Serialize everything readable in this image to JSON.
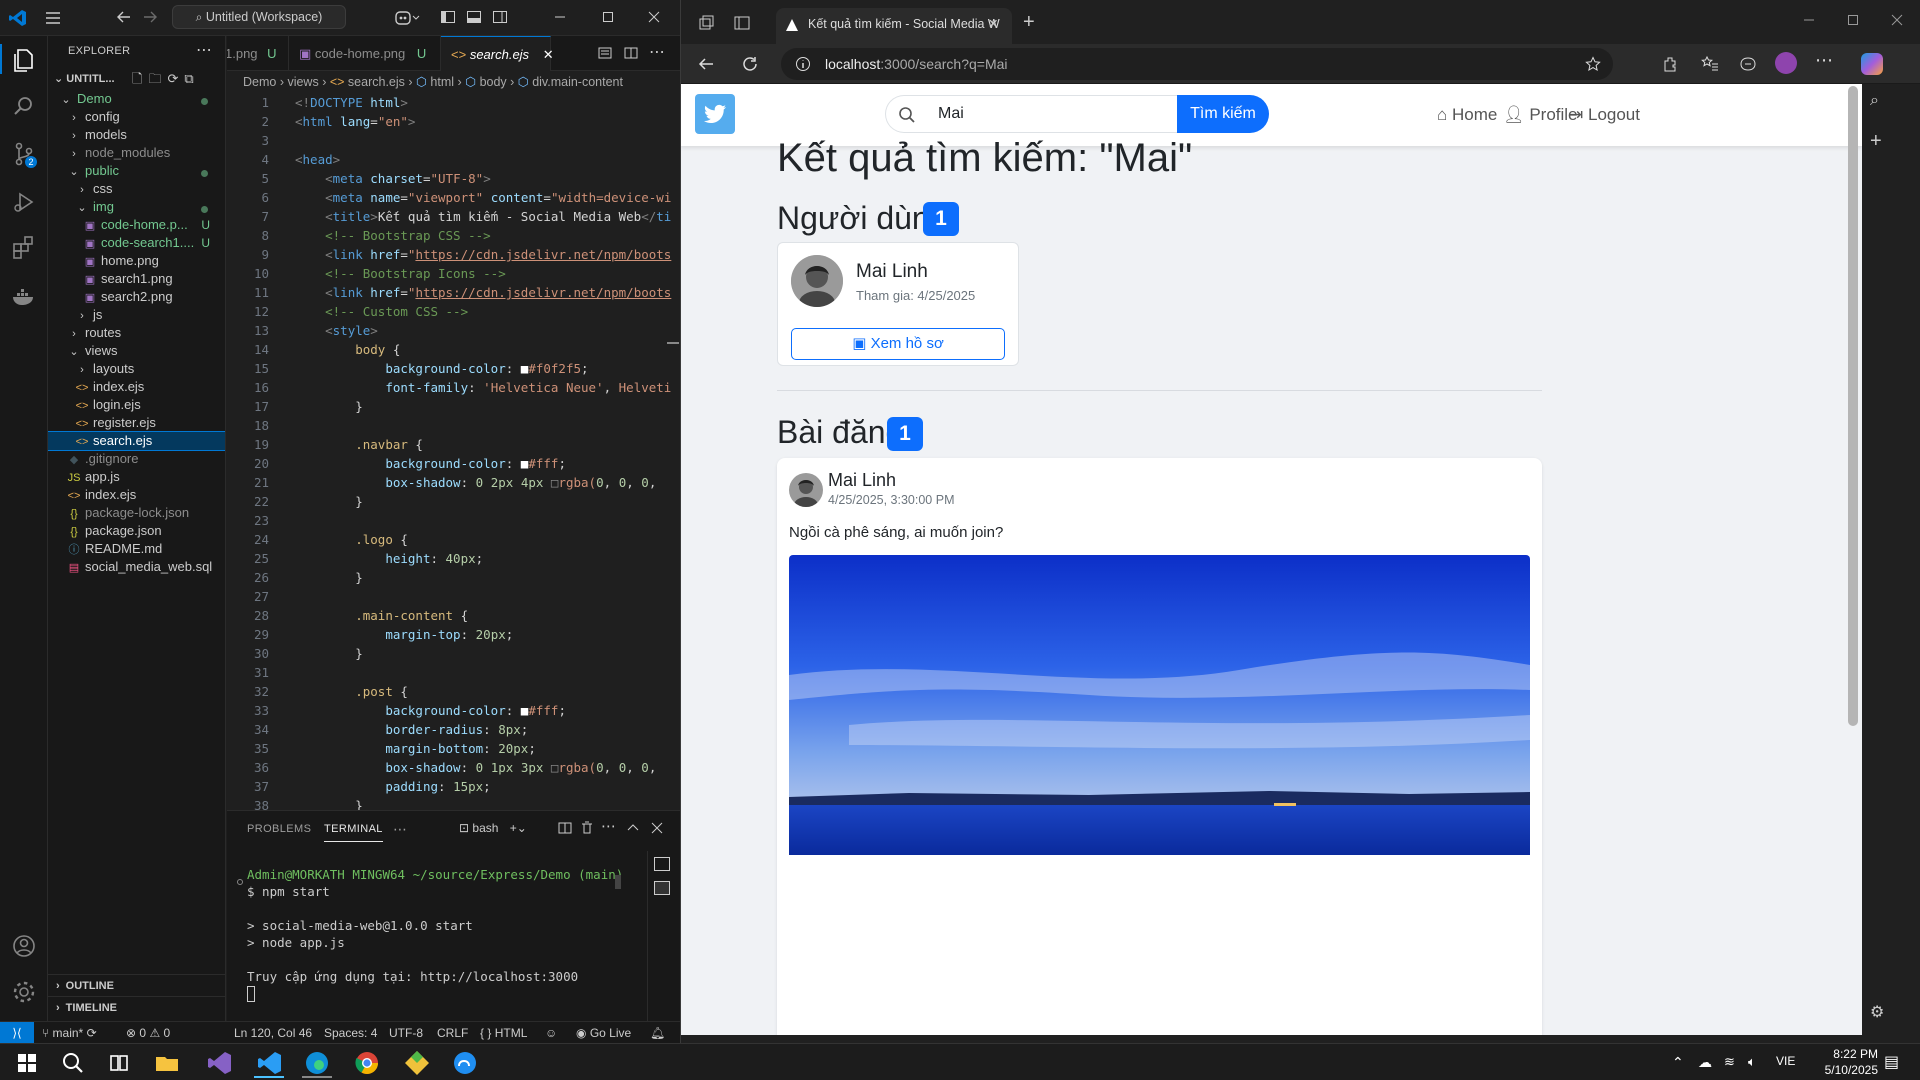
{
  "vscode": {
    "search_label": "Untitled (Workspace)",
    "explorer_title": "EXPLORER",
    "workspace": "UNTITL...",
    "tree": [
      {
        "label": "Demo",
        "depth": 1,
        "kind": "folder-open",
        "color": "#73c991",
        "dot": true
      },
      {
        "label": "config",
        "depth": 2,
        "kind": "folder",
        "color": "#ccc"
      },
      {
        "label": "models",
        "depth": 2,
        "kind": "folder",
        "color": "#ccc"
      },
      {
        "label": "node_modules",
        "depth": 2,
        "kind": "folder",
        "color": "#8c8c8c"
      },
      {
        "label": "public",
        "depth": 2,
        "kind": "folder-open",
        "color": "#73c991",
        "dot": true
      },
      {
        "label": "css",
        "depth": 3,
        "kind": "folder",
        "color": "#ccc"
      },
      {
        "label": "img",
        "depth": 3,
        "kind": "folder-open",
        "color": "#73c991",
        "dot": true
      },
      {
        "label": "code-home.p...",
        "depth": 4,
        "kind": "img",
        "color": "#73c991",
        "badge": "U"
      },
      {
        "label": "code-search1....",
        "depth": 4,
        "kind": "img",
        "color": "#73c991",
        "badge": "U"
      },
      {
        "label": "home.png",
        "depth": 4,
        "kind": "img",
        "color": "#ccc"
      },
      {
        "label": "search1.png",
        "depth": 4,
        "kind": "img",
        "color": "#ccc"
      },
      {
        "label": "search2.png",
        "depth": 4,
        "kind": "img",
        "color": "#ccc"
      },
      {
        "label": "js",
        "depth": 3,
        "kind": "folder",
        "color": "#ccc"
      },
      {
        "label": "routes",
        "depth": 2,
        "kind": "folder",
        "color": "#ccc"
      },
      {
        "label": "views",
        "depth": 2,
        "kind": "folder-open",
        "color": "#ccc"
      },
      {
        "label": "layouts",
        "depth": 3,
        "kind": "folder",
        "color": "#ccc"
      },
      {
        "label": "index.ejs",
        "depth": 3,
        "kind": "ejs",
        "color": "#ccc"
      },
      {
        "label": "login.ejs",
        "depth": 3,
        "kind": "ejs",
        "color": "#ccc"
      },
      {
        "label": "register.ejs",
        "depth": 3,
        "kind": "ejs",
        "color": "#ccc"
      },
      {
        "label": "search.ejs",
        "depth": 3,
        "kind": "ejs",
        "color": "#fff",
        "selected": true
      },
      {
        "label": ".gitignore",
        "depth": 2,
        "kind": "git",
        "color": "#8c8c8c"
      },
      {
        "label": "app.js",
        "depth": 2,
        "kind": "js",
        "color": "#ccc"
      },
      {
        "label": "index.ejs",
        "depth": 2,
        "kind": "ejs",
        "color": "#ccc"
      },
      {
        "label": "package-lock.json",
        "depth": 2,
        "kind": "json",
        "color": "#8c8c8c"
      },
      {
        "label": "package.json",
        "depth": 2,
        "kind": "json",
        "color": "#ccc"
      },
      {
        "label": "README.md",
        "depth": 2,
        "kind": "md",
        "color": "#ccc"
      },
      {
        "label": "social_media_web.sql",
        "depth": 2,
        "kind": "sql",
        "color": "#ccc"
      }
    ],
    "outline": "OUTLINE",
    "timeline": "TIMELINE",
    "tabs": [
      {
        "label": "1.png",
        "badge": "U",
        "active": false
      },
      {
        "label": "code-home.png",
        "badge": "U",
        "active": false
      },
      {
        "label": "search.ejs",
        "badge": "",
        "active": true
      }
    ],
    "breadcrumb": [
      "Demo",
      "views",
      "search.ejs",
      "html",
      "body",
      "div.main-content"
    ],
    "line_numbers": [
      "1",
      "2",
      "3",
      "4",
      "5",
      "6",
      "7",
      "8",
      "9",
      "10",
      "11",
      "12",
      "13",
      "14",
      "15",
      "16",
      "17",
      "18",
      "19",
      "20",
      "21",
      "22",
      "23",
      "24",
      "25",
      "26",
      "27",
      "28",
      "29",
      "30",
      "31",
      "32",
      "33",
      "34",
      "35",
      "36",
      "37",
      "38"
    ],
    "panel_tabs": [
      "PROBLEMS",
      "TERMINAL"
    ],
    "shell": "bash",
    "terminal": [
      "Admin@MORKATH MINGW64 ~/source/Express/Demo (main)",
      "$ npm start",
      "",
      "> social-media-web@1.0.0 start",
      "> node app.js",
      "",
      "Truy cập ứng dụng tại: http://localhost:3000"
    ],
    "status": {
      "branch": "main*",
      "problems": "0",
      "warnings": "0",
      "position": "Ln 120, Col 46",
      "spaces": "Spaces: 4",
      "encoding": "UTF-8",
      "eol": "CRLF",
      "language": "HTML",
      "golive": "Go Live"
    }
  },
  "browser": {
    "tab_title": "Kết quả tìm kiếm - Social Media W",
    "url_host": "localhost",
    "url_rest": ":3000/search?q=Mai",
    "page": {
      "search_value": "Mai",
      "search_button": "Tìm kiếm",
      "nav": {
        "home": "Home",
        "profile": "Profile",
        "logout": "Logout"
      },
      "heading": "Kết quả tìm kiếm: \"Mai\"",
      "users_heading": "Người dùng",
      "users_count": "1",
      "user": {
        "name": "Mai Linh",
        "joined": "Tham gia: 4/25/2025",
        "view_button": "Xem hồ sơ"
      },
      "posts_heading": "Bài đăng",
      "posts_count": "1",
      "post": {
        "author": "Mai Linh",
        "time": "4/25/2025, 3:30:00 PM",
        "content": "Ngồi cà phê sáng, ai muốn join?"
      }
    }
  },
  "taskbar": {
    "lang": "VIE",
    "time": "8:22 PM",
    "date": "5/10/2025"
  },
  "colors": {
    "primary": "#0d6efd",
    "twitter": "#55acee",
    "vscode_accent": "#0078d4"
  }
}
